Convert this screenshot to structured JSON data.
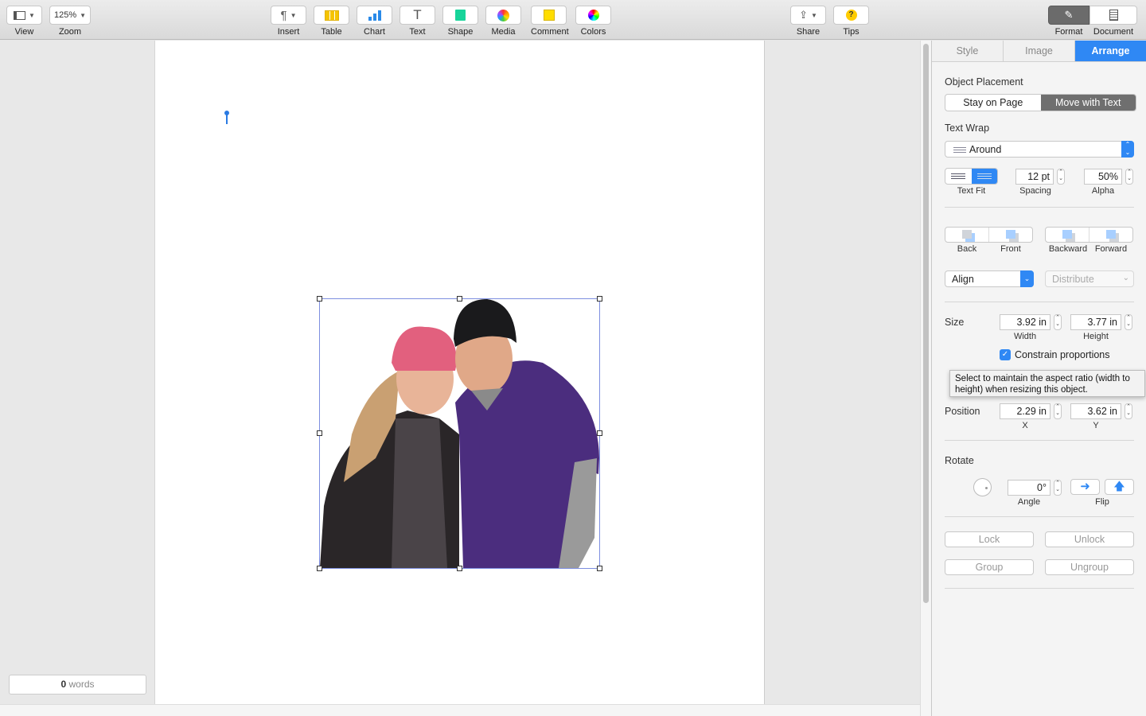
{
  "toolbar": {
    "view": "View",
    "zoom_value": "125%",
    "zoom": "Zoom",
    "insert": "Insert",
    "table": "Table",
    "chart": "Chart",
    "text": "Text",
    "shape": "Shape",
    "media": "Media",
    "comment": "Comment",
    "colors": "Colors",
    "share": "Share",
    "tips": "Tips",
    "format": "Format",
    "document": "Document"
  },
  "status": {
    "word_count": "0",
    "words_label": "words"
  },
  "inspector": {
    "tabs": [
      "Style",
      "Image",
      "Arrange"
    ],
    "active_tab": "Arrange",
    "object_placement": {
      "title": "Object Placement",
      "options": [
        "Stay on Page",
        "Move with Text"
      ],
      "selected": "Move with Text"
    },
    "text_wrap": {
      "title": "Text Wrap",
      "value": "Around",
      "text_fit": "Text Fit",
      "spacing": "12 pt",
      "spacing_label": "Spacing",
      "alpha": "50%",
      "alpha_label": "Alpha"
    },
    "arrange": {
      "back": "Back",
      "front": "Front",
      "backward": "Backward",
      "forward": "Forward"
    },
    "align": "Align",
    "distribute": "Distribute",
    "size": {
      "title": "Size",
      "width": "3.92 in",
      "width_label": "Width",
      "height": "3.77 in",
      "height_label": "Height",
      "constrain": "Constrain proportions",
      "constrain_checked": true
    },
    "tooltip": "Select to maintain the aspect ratio (width to height) when resizing this object.",
    "position": {
      "title": "Position",
      "x": "2.29 in",
      "x_label": "X",
      "y": "3.62 in",
      "y_label": "Y"
    },
    "rotate": {
      "title": "Rotate",
      "angle": "0°",
      "angle_label": "Angle",
      "flip_label": "Flip"
    },
    "lock": "Lock",
    "unlock": "Unlock",
    "group": "Group",
    "ungroup": "Ungroup"
  },
  "colors": {
    "accent": "#2f88f4",
    "segment_selected": "#6f6f6f"
  }
}
